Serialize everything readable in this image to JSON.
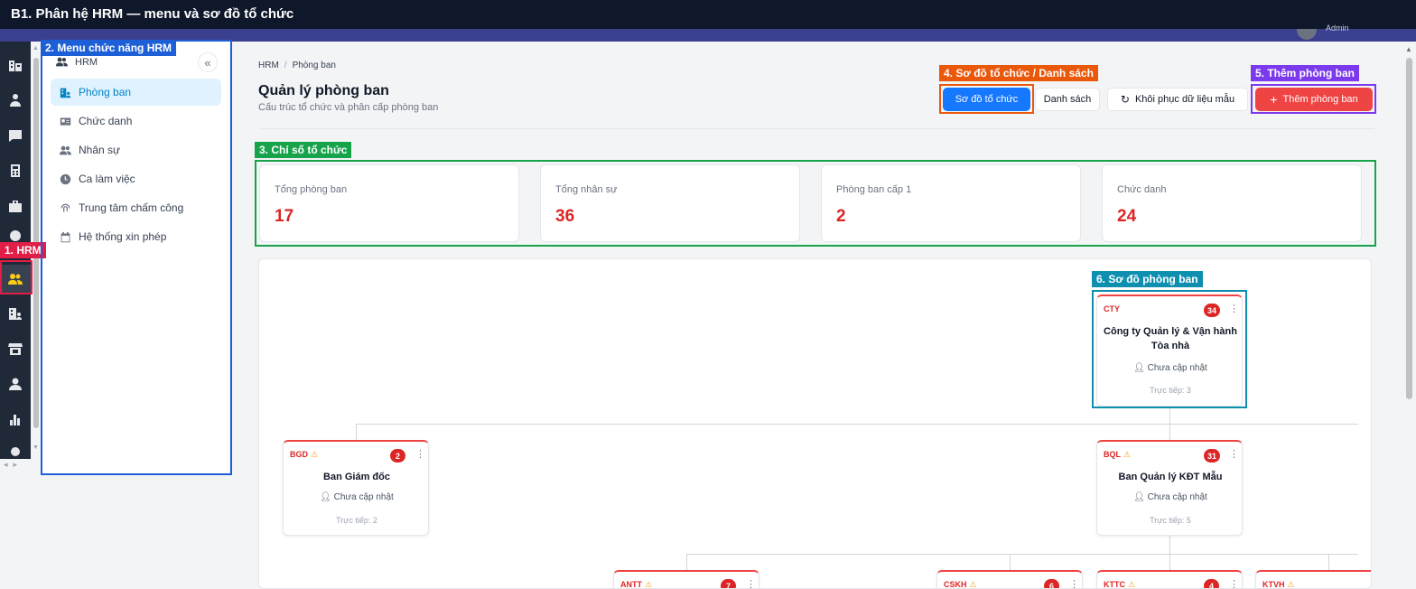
{
  "title": "B1. Phân hệ HRM — menu và sơ đồ tổ chức",
  "user": {
    "name": "Admin"
  },
  "annotations": {
    "hrm": "1. HRM",
    "menu": "2. Menu chức năng HRM",
    "stats": "3. Chỉ số tổ chức",
    "view_toggle": "4. Sơ đồ tổ chức / Danh sách",
    "add": "5. Thêm phòng ban",
    "org_chart": "6. Sơ đồ phòng ban"
  },
  "annotation_colors": {
    "hrm": "#e11d48",
    "menu": "#1d5fd6",
    "stats": "#16a34a",
    "view_toggle": "#ea580c",
    "add": "#7c3aed",
    "org_chart": "#0e8fb0"
  },
  "sidebar_icons": [
    "building-icon",
    "user-cog-icon",
    "chat-icon",
    "calculator-icon",
    "briefcase-icon",
    "cloud-icon",
    "users-icon",
    "building-user-icon",
    "store-icon",
    "user-icon",
    "bar-chart-icon",
    "gear-icon"
  ],
  "submenu": {
    "header": "HRM",
    "collapse": "«",
    "items": [
      {
        "label": "Phòng ban",
        "icon": "department-icon",
        "active": true
      },
      {
        "label": "Chức danh",
        "icon": "id-card-icon",
        "active": false
      },
      {
        "label": "Nhân sự",
        "icon": "users-icon",
        "active": false
      },
      {
        "label": "Ca làm việc",
        "icon": "clock-icon",
        "active": false
      },
      {
        "label": "Trung tâm chấm công",
        "icon": "fingerprint-icon",
        "active": false
      },
      {
        "label": "Hệ thống xin phép",
        "icon": "calendar-icon",
        "active": false
      }
    ]
  },
  "breadcrumb": {
    "root": "HRM",
    "separator": "/",
    "current": "Phòng ban"
  },
  "page": {
    "title": "Quản lý phòng ban",
    "subtitle": "Cấu trúc tổ chức và phân cấp phòng ban"
  },
  "actions": {
    "org_chart": "Sơ đồ tổ chức",
    "list": "Danh sách",
    "restore": "Khôi phục dữ liệu mẫu",
    "add": "Thêm phòng ban"
  },
  "stats": [
    {
      "label": "Tổng phòng ban",
      "value": "17"
    },
    {
      "label": "Tổng nhân sự",
      "value": "36"
    },
    {
      "label": "Phòng ban cấp 1",
      "value": "2"
    },
    {
      "label": "Chức danh",
      "value": "24"
    }
  ],
  "org": {
    "root": {
      "code": "CTY",
      "count": "34",
      "name": "Công ty Quản lý & Vận hành Tòa nhà",
      "manager": "Chưa cập nhật",
      "direct": "Trực tiếp: 3"
    },
    "level1": [
      {
        "code": "BGD",
        "count": "2",
        "name": "Ban Giám đốc",
        "manager": "Chưa cập nhật",
        "direct": "Trực tiếp: 2"
      },
      {
        "code": "BQL",
        "count": "31",
        "name": "Ban Quản lý KĐT Mẫu",
        "manager": "Chưa cập nhật",
        "direct": "Trực tiếp: 5"
      }
    ],
    "level2": [
      {
        "code": "ANTT",
        "count": "7"
      },
      {
        "code": "CSKH",
        "count": "6"
      },
      {
        "code": "KTTC",
        "count": "4"
      },
      {
        "code": "KTVH",
        "count": ""
      }
    ]
  }
}
